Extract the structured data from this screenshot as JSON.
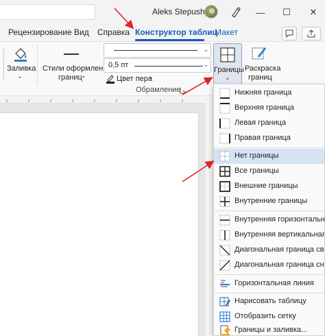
{
  "titlebar": {
    "user_name": "Aleks Stepushyn",
    "window_controls": {
      "minimize": "—",
      "maximize": "☐",
      "close": "✕"
    }
  },
  "tabs": [
    {
      "label": "Рецензирование"
    },
    {
      "label": "Вид"
    },
    {
      "label": "Справка"
    },
    {
      "label": "Конструктор таблиц",
      "active": true
    },
    {
      "label": "Макет"
    }
  ],
  "ribbon": {
    "fill_label": "Заливка",
    "styles_label_line1": "Стили оформления",
    "styles_label_line2": "границ",
    "pen_weight": "0,5 пт",
    "pen_color_label": "Цвет пера",
    "borders_label": "Границы",
    "painter_line1": "Раскраска",
    "painter_line2": "границ",
    "group_label": "Обрамление"
  },
  "borders_menu": {
    "items": [
      {
        "label": "Нижняя граница",
        "icon": "bottom-border-icon"
      },
      {
        "label": "Верхняя граница",
        "icon": "top-border-icon"
      },
      {
        "label": "Левая граница",
        "icon": "left-border-icon"
      },
      {
        "label": "Правая граница",
        "icon": "right-border-icon"
      },
      {
        "label": "Нет границы",
        "icon": "no-border-icon",
        "highlighted": true
      },
      {
        "label": "Все границы",
        "icon": "all-borders-icon"
      },
      {
        "label": "Внешние границы",
        "icon": "outside-borders-icon"
      },
      {
        "label": "Внутренние границы",
        "icon": "inside-borders-icon"
      },
      {
        "label": "Внутренняя горизонтальная граница",
        "icon": "inside-horizontal-border-icon"
      },
      {
        "label": "Внутренняя вертикальная граница",
        "icon": "inside-vertical-border-icon"
      },
      {
        "label": "Диагональная граница сверху вниз",
        "icon": "diagonal-down-border-icon"
      },
      {
        "label": "Диагональная граница снизу вверх",
        "icon": "diagonal-up-border-icon"
      },
      {
        "label": "Горизонтальная линия",
        "icon": "horizontal-line-icon"
      },
      {
        "label": "Нарисовать таблицу",
        "icon": "draw-table-icon"
      },
      {
        "label": "Отобразить сетку",
        "icon": "view-gridlines-icon"
      },
      {
        "label": "Границы и заливка...",
        "icon": "borders-shading-icon"
      }
    ]
  },
  "colors": {
    "accent": "#185abd",
    "highlight": "#d5e3f5",
    "annotation_arrow": "#e0242a"
  }
}
